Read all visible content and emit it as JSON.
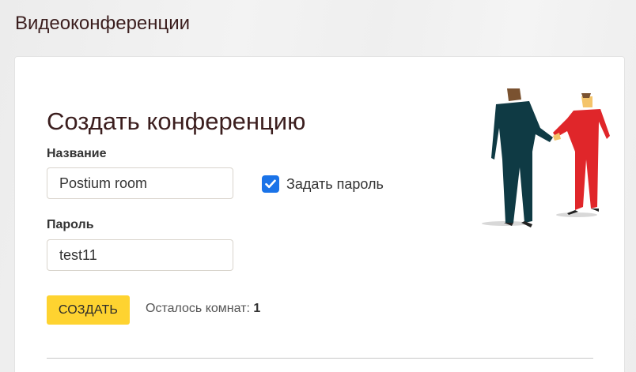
{
  "page": {
    "title": "Видеоконференции"
  },
  "form": {
    "title": "Создать конференцию",
    "name_label": "Название",
    "name_value": "Postium room",
    "password_label": "Пароль",
    "password_value": "test11",
    "set_password_label": "Задать пароль",
    "set_password_checked": true,
    "create_button": "СОЗДАТЬ",
    "rooms_left_label": "Осталось комнат: ",
    "rooms_left_count": "1"
  },
  "colors": {
    "accent_button": "#fed330",
    "checkbox": "#1a73e8",
    "title_text": "#3b1e1e"
  },
  "icons": {
    "checkbox": "checkmark-icon",
    "illustration": "handshake-illustration"
  }
}
